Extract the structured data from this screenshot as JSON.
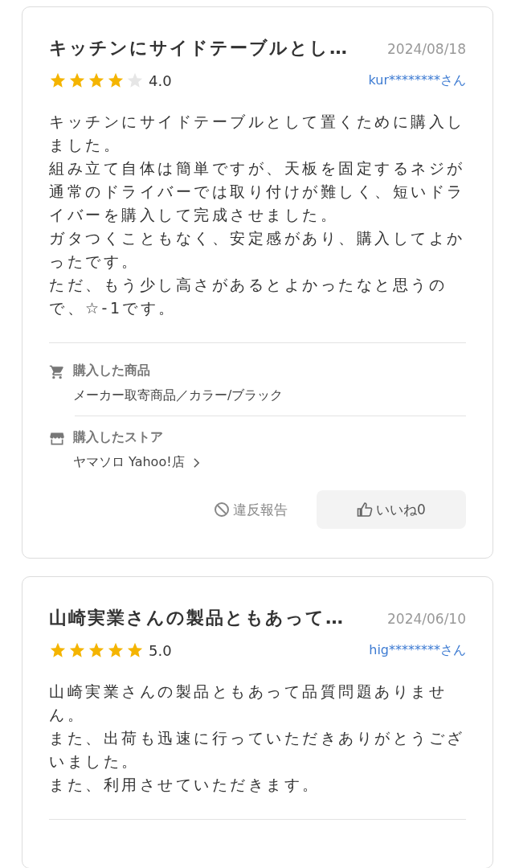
{
  "reviews": [
    {
      "title": "キッチンにサイドテーブルとし…",
      "date": "2024/08/18",
      "stars": 4,
      "rating": "4.0",
      "user": "kur********さん",
      "body": [
        "キッチンにサイドテーブルとして置くために購入しました。",
        "組み立て自体は簡単ですが、天板を固定するネジが通常のドライバーでは取り付けが難しく、短いドライバーを購入して完成させました。",
        "ガタつくこともなく、安定感があり、購入してよかったです。",
        "ただ、もう少し高さがあるとよかったなと思うので、☆-1です。"
      ],
      "product": {
        "label": "購入した商品",
        "value": "メーカー取寄商品／カラー/ブラック"
      },
      "store": {
        "label": "購入したストア",
        "value": "ヤマソロ Yahoo!店"
      },
      "report": "違反報告",
      "like": "いいね0"
    },
    {
      "title": "山崎実業さんの製品ともあって…",
      "date": "2024/06/10",
      "stars": 5,
      "rating": "5.0",
      "user": "hig********さん",
      "body": [
        "山崎実業さんの製品ともあって品質問題ありません。",
        "また、出荷も迅速に行っていただきありがとうございました。",
        "また、利用させていただきます。"
      ]
    }
  ]
}
